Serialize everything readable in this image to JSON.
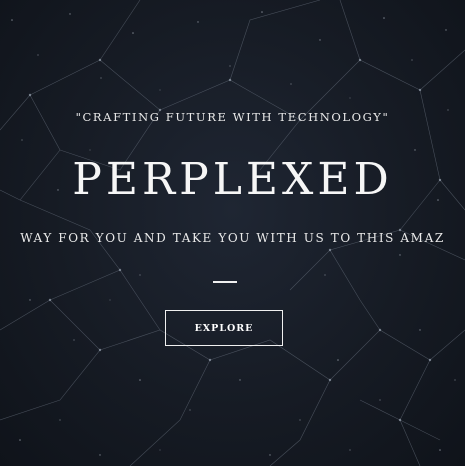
{
  "hero": {
    "tagline": "\"CRAFTING FUTURE WITH TECHNOLOGY\"",
    "title": "PERPLEXED",
    "subtitle": "WAY FOR YOU AND TAKE YOU WITH US TO THIS AMAZ",
    "explore_label": "EXPLORE"
  },
  "colors": {
    "background": "#141820",
    "text": "#f6f6f6",
    "network_lines": "#6f7886"
  }
}
